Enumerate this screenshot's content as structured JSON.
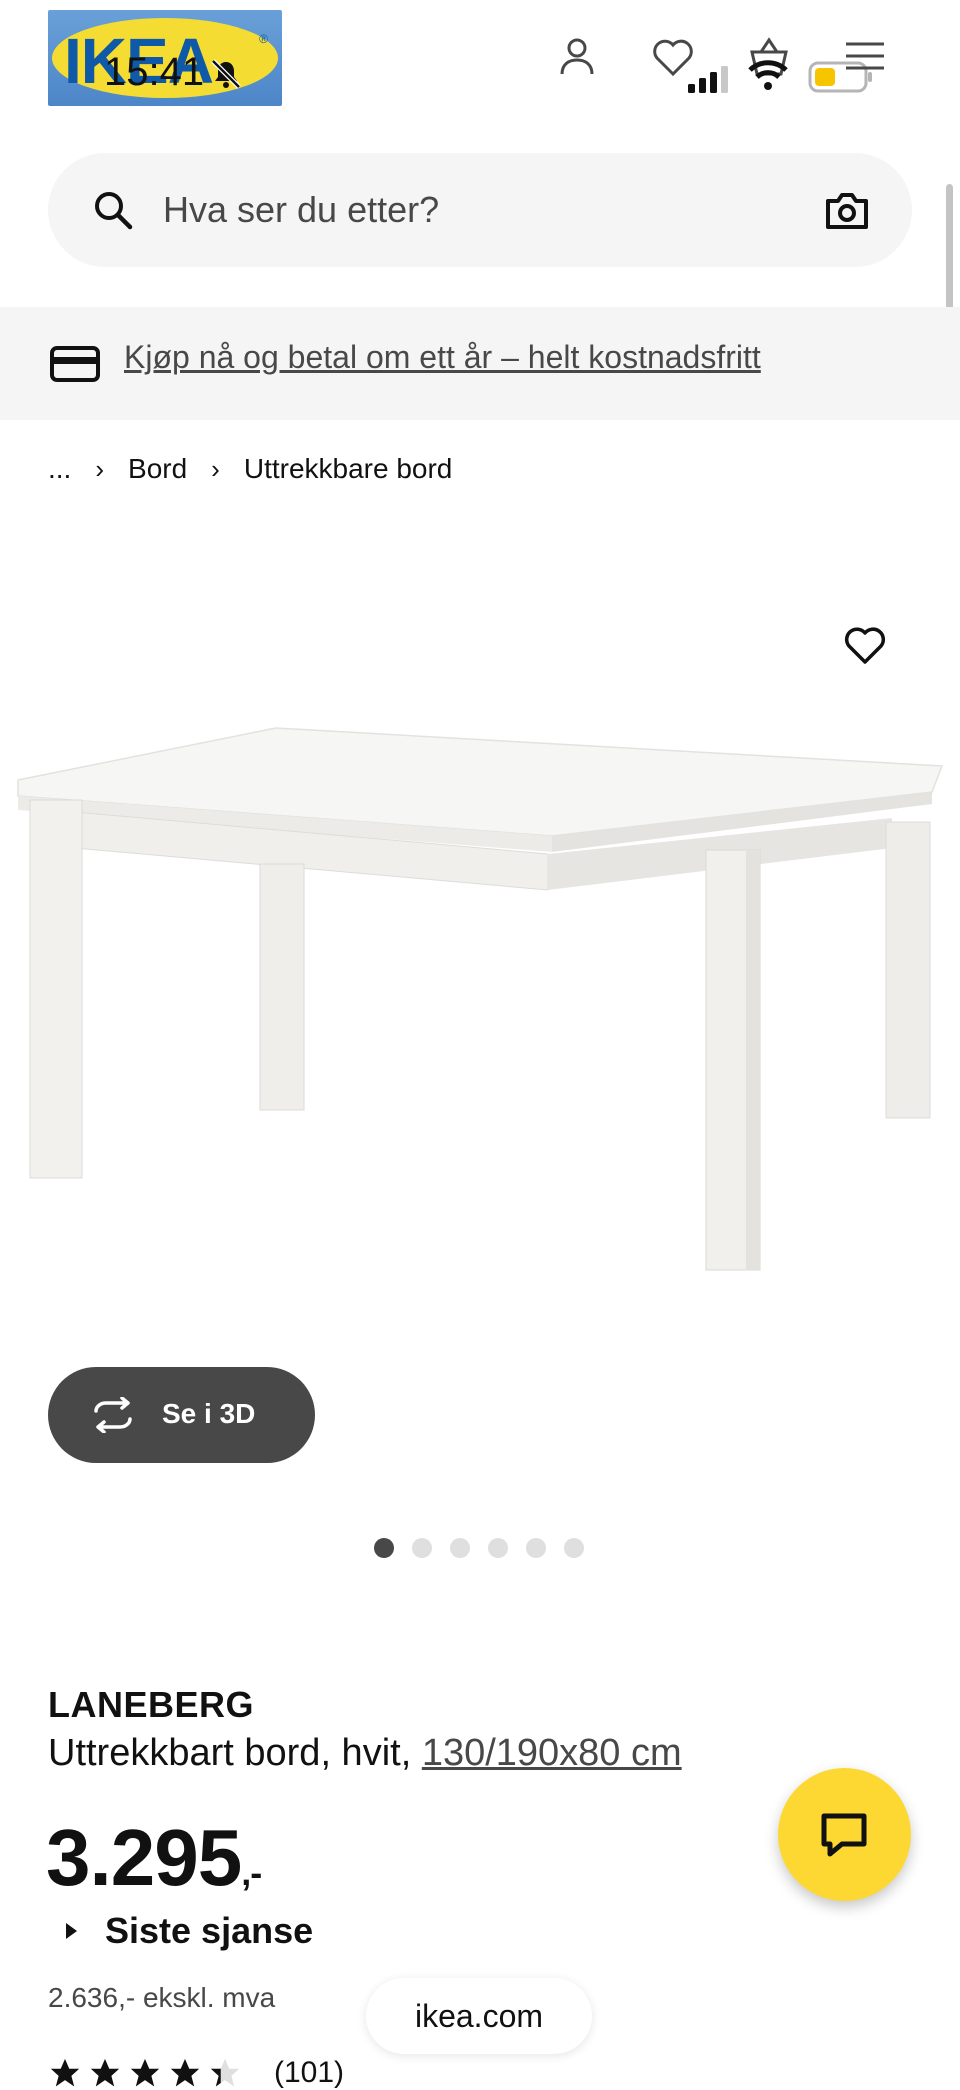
{
  "status_bar": {
    "time": "15:41"
  },
  "header": {
    "logo_text": "IKEA"
  },
  "search": {
    "placeholder": "Hva ser du etter?"
  },
  "promo": {
    "text": "Kjøp nå og betal om ett år – helt kostnadsfritt"
  },
  "breadcrumb": {
    "items": [
      "...",
      "Bord",
      "Uttrekkbare bord"
    ]
  },
  "gallery": {
    "button_3d_label": "Se i 3D",
    "image_count": 6,
    "active_index": 0
  },
  "product": {
    "name": "LANEBERG",
    "description": "Uttrekkbart bord, hvit,",
    "size": "130/190x80 cm",
    "price": "3.295",
    "price_suffix": ",-",
    "badge": "Siste sjanse",
    "price_ex_vat": "2.636,- ekskl. mva",
    "rating": 4.3,
    "review_count": "(101)"
  },
  "browser": {
    "url": "ikea.com"
  },
  "colors": {
    "brand_blue": "#0058a3",
    "brand_yellow": "#fdd832",
    "dark_grey": "#484848"
  }
}
